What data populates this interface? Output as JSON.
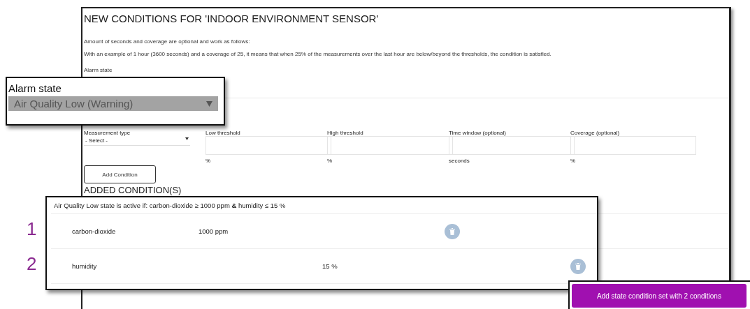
{
  "panel": {
    "title": "NEW CONDITIONS FOR 'INDOOR ENVIRONMENT SENSOR'",
    "intro": [
      "Amount of seconds and coverage are optional and work as follows:",
      "With an example of 1 hour (3600 seconds) and a coverage of 25, it means that when 25% of the measurements over the last hour are below/beyond the thresholds, the condition is satisfied."
    ],
    "alarm_label": "Alarm state",
    "fields": [
      {
        "kind": "select",
        "label": "Measurement type",
        "value": "- Select -"
      },
      {
        "kind": "input",
        "label": "Low threshold",
        "unit": "%"
      },
      {
        "kind": "input",
        "label": "High threshold",
        "unit": "%"
      },
      {
        "kind": "input",
        "label": "Time window (optional)",
        "unit": "seconds"
      },
      {
        "kind": "input",
        "label": "Coverage (optional)",
        "unit": "%"
      }
    ],
    "add_button": "Add Condition",
    "added_heading": "ADDED CONDITION(S)"
  },
  "alarm_callout": {
    "label": "Alarm state",
    "value": "Air Quality Low (Warning)"
  },
  "conditions_callout": {
    "summary": "Air Quality Low state is active if: carbon-dioxide ≥ 1000 ppm **&** humidity ≤ 15 %",
    "rows": [
      {
        "marker": "1",
        "name": "carbon-dioxide",
        "low": "1000 ppm"
      },
      {
        "marker": "2",
        "name": "humidity",
        "high": "15 %"
      }
    ]
  },
  "submit_button": "Add state condition set with 2 conditions"
}
